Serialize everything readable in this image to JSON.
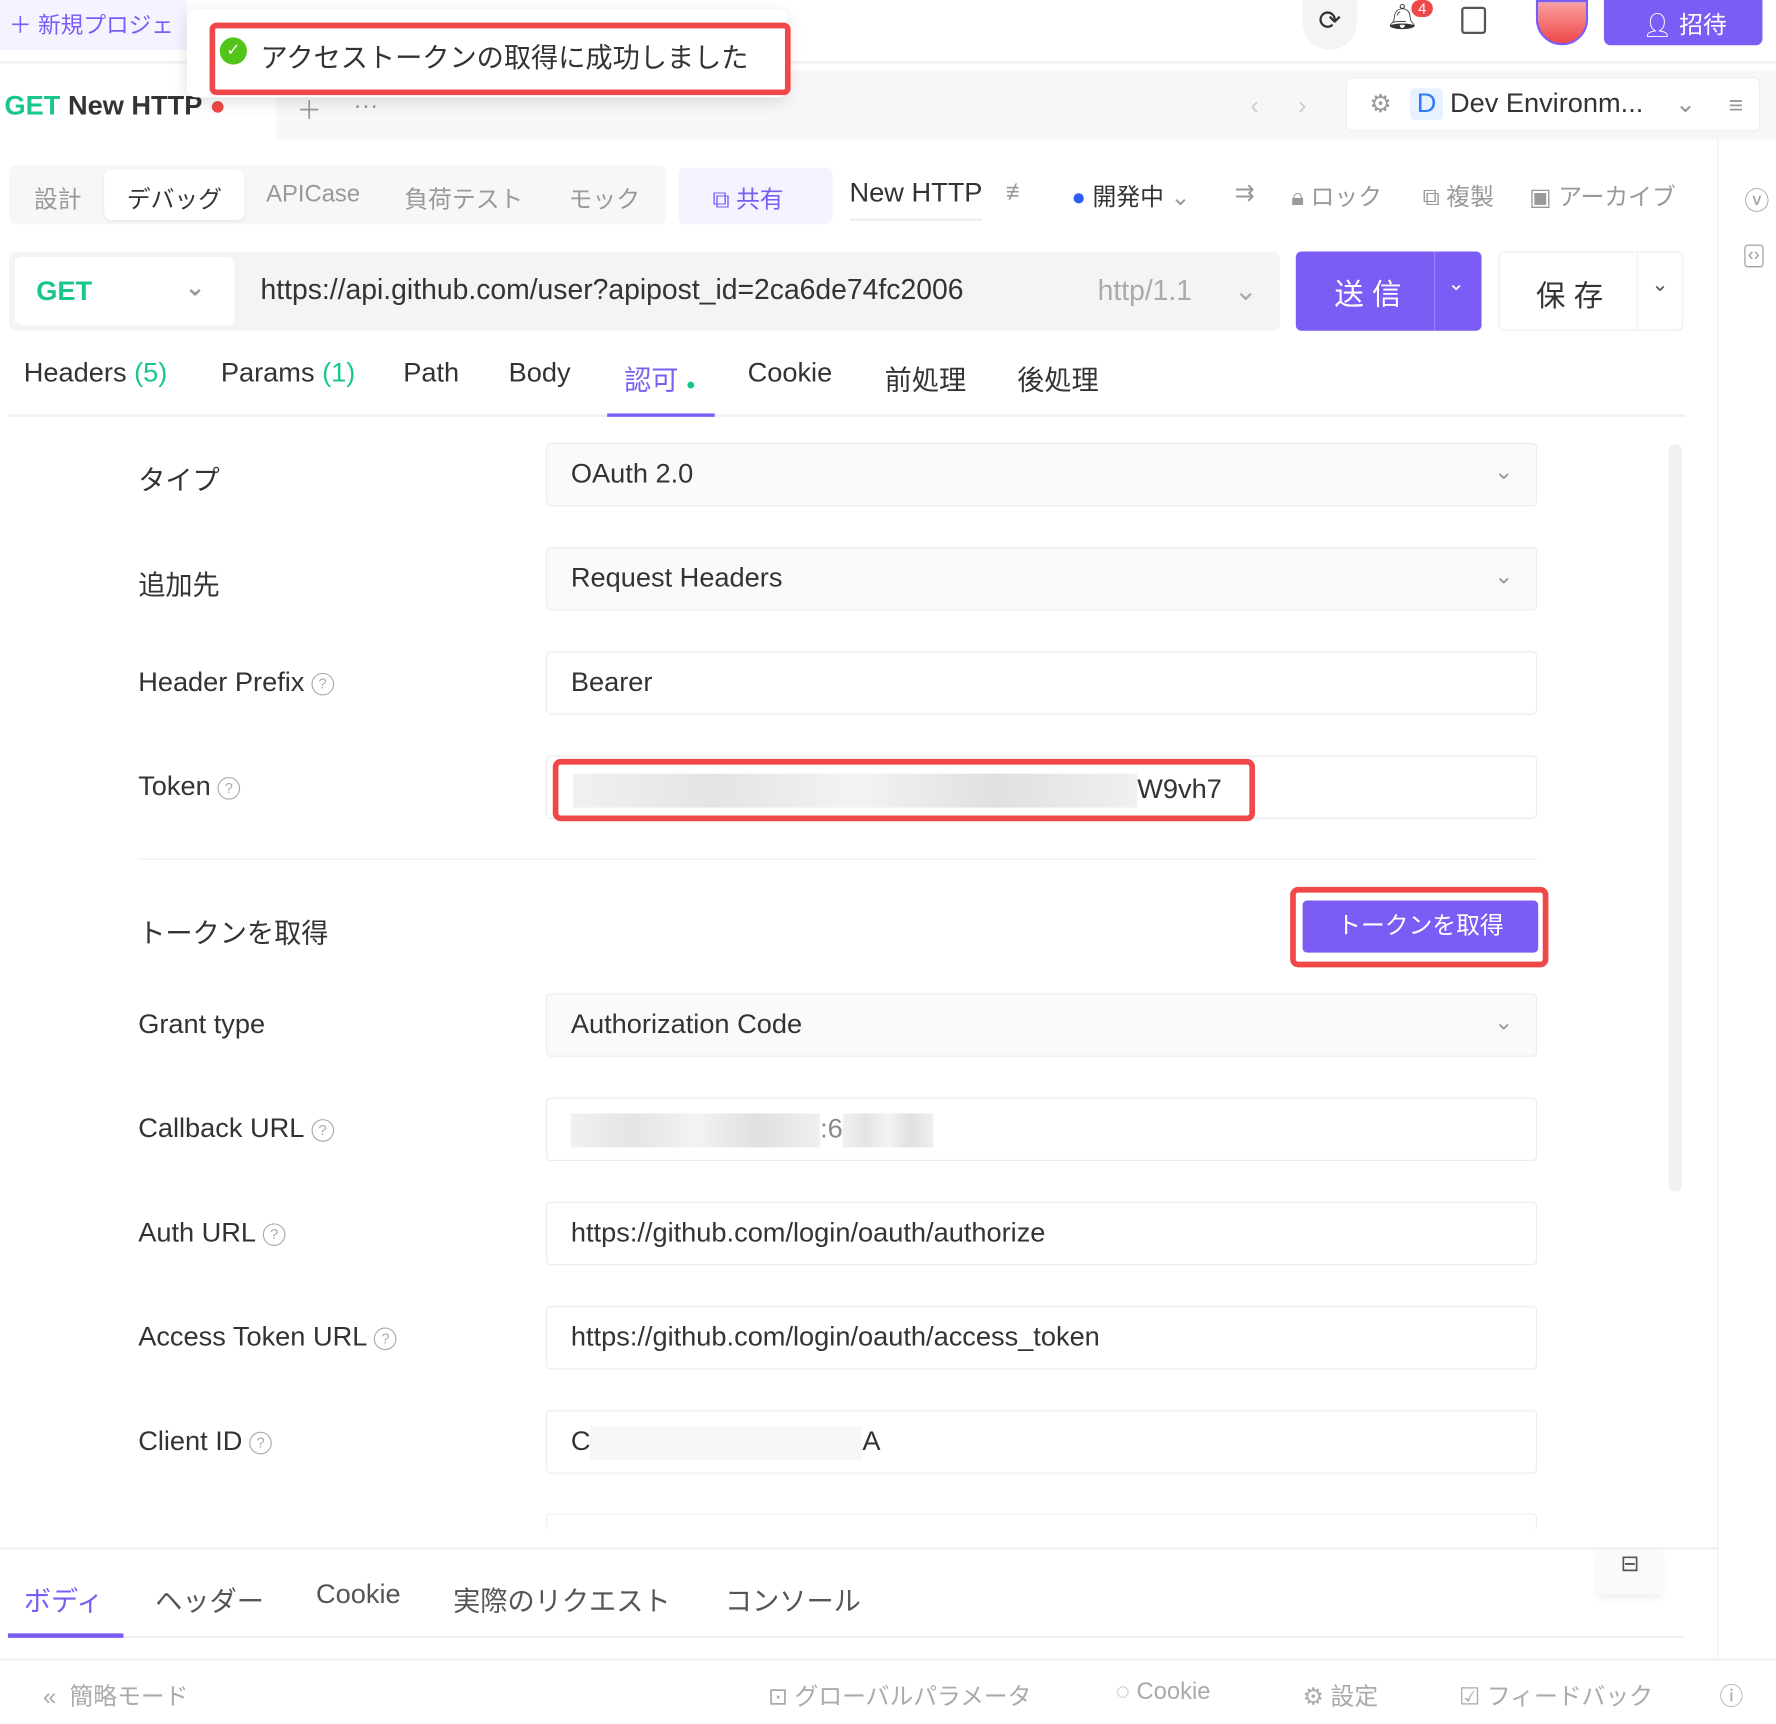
{
  "topbar": {
    "new_project": "新規プロジェ",
    "notification_count": "4",
    "invite_label": "招待",
    "icons": [
      "refresh-icon",
      "bell-icon",
      "document-icon",
      "avatar",
      "user-plus-icon"
    ]
  },
  "toast": {
    "message": "アクセストークンの取得に成功しました",
    "icon": "check-circle-icon"
  },
  "request_tab": {
    "method": "GET",
    "name": "New HTTP",
    "unsaved_color": "#f04848"
  },
  "environment": {
    "badge": "D",
    "name": "Dev Environm..."
  },
  "mode_tabs": [
    {
      "label": "設計"
    },
    {
      "label": "デバッグ",
      "active": true
    },
    {
      "label": "APICase"
    },
    {
      "label": "負荷テスト"
    },
    {
      "label": "モック"
    }
  ],
  "toolbar": {
    "share": "共有",
    "name": "New HTTP",
    "status": "開発中",
    "lock": "ロック",
    "copy": "複製",
    "archive": "アーカイブ"
  },
  "url_bar": {
    "method": "GET",
    "url": "https://api.github.com/user?apipost_id=2ca6de74fc2006",
    "protocol": "http/1.1",
    "send": "送 信",
    "save": "保 存"
  },
  "sub_tabs": [
    {
      "label": "Headers",
      "count": "(5)"
    },
    {
      "label": "Params",
      "count": "(1)"
    },
    {
      "label": "Path"
    },
    {
      "label": "Body"
    },
    {
      "label": "認可",
      "active": true
    },
    {
      "label": "Cookie"
    },
    {
      "label": "前処理"
    },
    {
      "label": "後処理"
    }
  ],
  "auth": {
    "type_label": "タイプ",
    "type_value": "OAuth 2.0",
    "add_to_label": "追加先",
    "add_to_value": "Request Headers",
    "prefix_label": "Header Prefix",
    "prefix_value": "Bearer",
    "token_label": "Token",
    "token_value_visible": "W9vh7",
    "get_token_label": "トークンを取得",
    "get_token_button": "トークンを取得",
    "grant_label": "Grant type",
    "grant_value": "Authorization Code",
    "callback_label": "Callback URL",
    "callback_value_visible": ":6",
    "auth_url_label": "Auth URL",
    "auth_url_value": "https://github.com/login/oauth/authorize",
    "access_url_label": "Access Token URL",
    "access_url_value": "https://github.com/login/oauth/access_token",
    "client_id_label": "Client ID",
    "client_id_start": "C",
    "client_id_end": "A"
  },
  "bottom_tabs": [
    {
      "label": "ボディ",
      "active": true
    },
    {
      "label": "ヘッダー"
    },
    {
      "label": "Cookie"
    },
    {
      "label": "実際のリクエスト"
    },
    {
      "label": "コンソール"
    }
  ],
  "footer": {
    "simple_mode": "簡略モード",
    "global_params": "グローバルパラメータ",
    "cookie": "Cookie",
    "settings": "設定",
    "feedback": "フィードバック"
  },
  "colors": {
    "accent": "#7b5cf5",
    "get": "#1ac78a",
    "highlight": "#f04848",
    "success": "#52c41a"
  }
}
